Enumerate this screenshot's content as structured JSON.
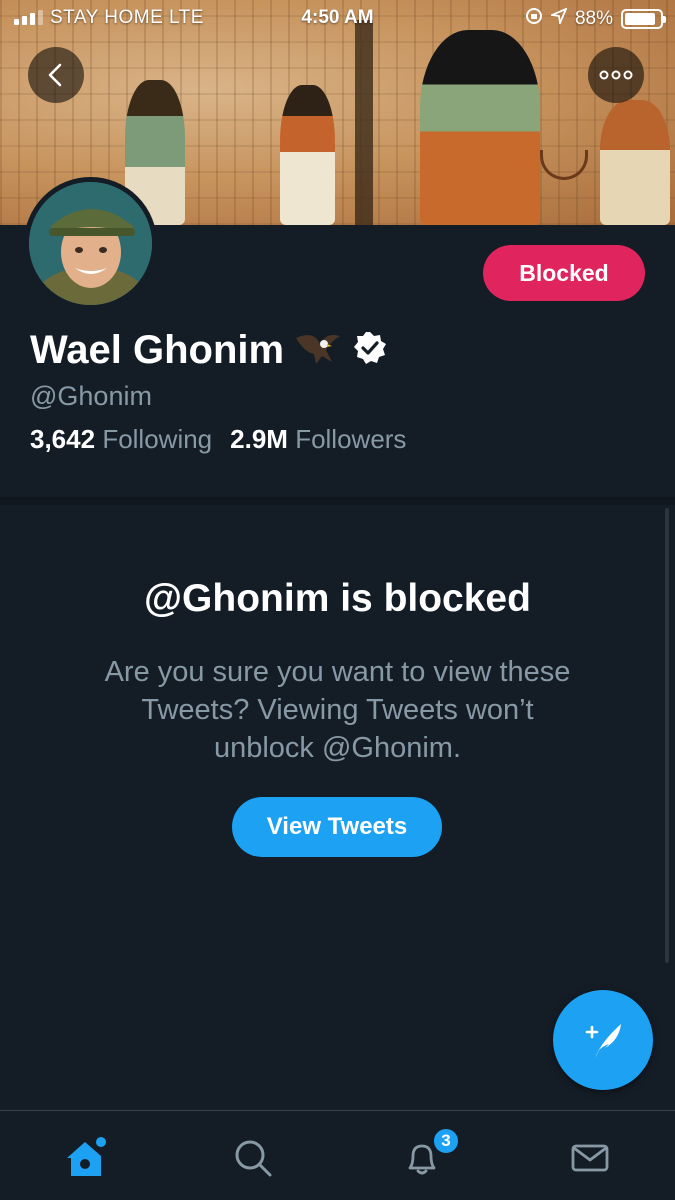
{
  "status_bar": {
    "carrier": "STAY HOME  LTE",
    "time": "4:50 AM",
    "battery": "88%",
    "battery_level": 0.88
  },
  "header": {
    "back_icon": "chevron-left-icon",
    "more_icon": "more-dots-icon"
  },
  "profile": {
    "name": "Wael Ghonim",
    "handle": "@Ghonim",
    "following_count": "3,642",
    "following_label": "Following",
    "followers_count": "2.9M",
    "followers_label": "Followers",
    "blocked_button": "Blocked",
    "verified": true
  },
  "blocked_notice": {
    "title": "@Ghonim is blocked",
    "message": "Are you sure you want to view these Tweets? Viewing Tweets won’t unblock @Ghonim.",
    "button": "View Tweets"
  },
  "tab_bar": {
    "items": [
      {
        "name": "home",
        "icon": "home-icon",
        "active": true
      },
      {
        "name": "search",
        "icon": "search-icon"
      },
      {
        "name": "notifications",
        "icon": "bell-icon",
        "badge": "3"
      },
      {
        "name": "messages",
        "icon": "envelope-icon"
      }
    ]
  },
  "colors": {
    "background": "#141d26",
    "accent": "#1da1f2",
    "blocked": "#e0245e",
    "secondary_text": "#8899a6"
  }
}
